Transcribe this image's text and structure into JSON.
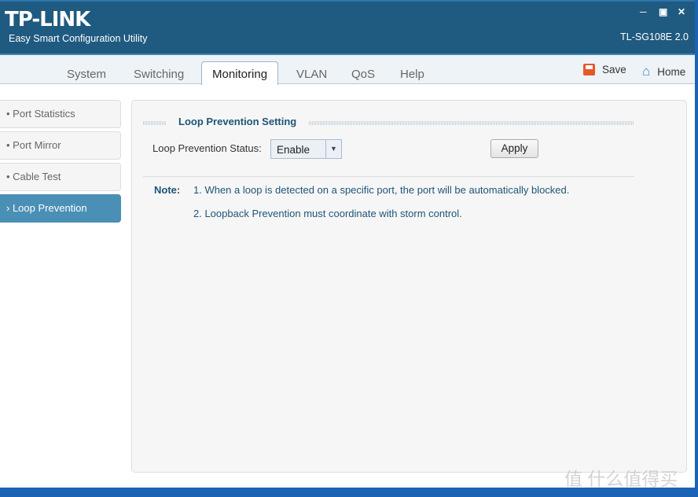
{
  "header": {
    "logo": "TP-LINK",
    "subtitle": "Easy Smart Configuration Utility",
    "model": "TL-SG108E 2.0",
    "window_controls": [
      "minimize-icon",
      "maximize-icon",
      "close-icon"
    ]
  },
  "tabs": [
    {
      "label": "System"
    },
    {
      "label": "Switching"
    },
    {
      "label": "Monitoring",
      "active": true
    },
    {
      "label": "VLAN"
    },
    {
      "label": "QoS"
    },
    {
      "label": "Help"
    }
  ],
  "toolbar": {
    "save_label": "Save",
    "home_label": "Home",
    "save_icon": "floppy-disk-icon",
    "home_icon": "house-icon"
  },
  "sidebar": {
    "items": [
      {
        "label": "Port Statistics"
      },
      {
        "label": "Port Mirror"
      },
      {
        "label": "Cable Test"
      },
      {
        "label": "Loop Prevention",
        "active": true
      }
    ]
  },
  "main": {
    "section_title": "Loop Prevention Setting",
    "status_label": "Loop Prevention Status:",
    "status_value": "Enable",
    "apply_label": "Apply",
    "note_label": "Note:",
    "notes": [
      "1. When a loop is detected on a specific port, the port will be automatically blocked.",
      "2. Loopback Prevention must coordinate with storm control."
    ]
  },
  "watermark": "值 什么值得买",
  "colors": {
    "header": "#1f5a80",
    "active_item": "#4a8fb6",
    "heading": "#1d5577"
  }
}
